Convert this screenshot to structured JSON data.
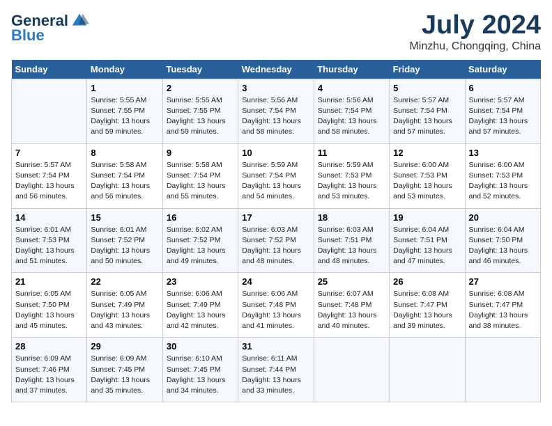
{
  "header": {
    "logo_general": "General",
    "logo_blue": "Blue",
    "title": "July 2024",
    "location": "Minzhu, Chongqing, China"
  },
  "days_of_week": [
    "Sunday",
    "Monday",
    "Tuesday",
    "Wednesday",
    "Thursday",
    "Friday",
    "Saturday"
  ],
  "weeks": [
    [
      {
        "day": "",
        "info": ""
      },
      {
        "day": "1",
        "info": "Sunrise: 5:55 AM\nSunset: 7:55 PM\nDaylight: 13 hours\nand 59 minutes."
      },
      {
        "day": "2",
        "info": "Sunrise: 5:55 AM\nSunset: 7:55 PM\nDaylight: 13 hours\nand 59 minutes."
      },
      {
        "day": "3",
        "info": "Sunrise: 5:56 AM\nSunset: 7:54 PM\nDaylight: 13 hours\nand 58 minutes."
      },
      {
        "day": "4",
        "info": "Sunrise: 5:56 AM\nSunset: 7:54 PM\nDaylight: 13 hours\nand 58 minutes."
      },
      {
        "day": "5",
        "info": "Sunrise: 5:57 AM\nSunset: 7:54 PM\nDaylight: 13 hours\nand 57 minutes."
      },
      {
        "day": "6",
        "info": "Sunrise: 5:57 AM\nSunset: 7:54 PM\nDaylight: 13 hours\nand 57 minutes."
      }
    ],
    [
      {
        "day": "7",
        "info": "Sunrise: 5:57 AM\nSunset: 7:54 PM\nDaylight: 13 hours\nand 56 minutes."
      },
      {
        "day": "8",
        "info": "Sunrise: 5:58 AM\nSunset: 7:54 PM\nDaylight: 13 hours\nand 56 minutes."
      },
      {
        "day": "9",
        "info": "Sunrise: 5:58 AM\nSunset: 7:54 PM\nDaylight: 13 hours\nand 55 minutes."
      },
      {
        "day": "10",
        "info": "Sunrise: 5:59 AM\nSunset: 7:54 PM\nDaylight: 13 hours\nand 54 minutes."
      },
      {
        "day": "11",
        "info": "Sunrise: 5:59 AM\nSunset: 7:53 PM\nDaylight: 13 hours\nand 53 minutes."
      },
      {
        "day": "12",
        "info": "Sunrise: 6:00 AM\nSunset: 7:53 PM\nDaylight: 13 hours\nand 53 minutes."
      },
      {
        "day": "13",
        "info": "Sunrise: 6:00 AM\nSunset: 7:53 PM\nDaylight: 13 hours\nand 52 minutes."
      }
    ],
    [
      {
        "day": "14",
        "info": "Sunrise: 6:01 AM\nSunset: 7:53 PM\nDaylight: 13 hours\nand 51 minutes."
      },
      {
        "day": "15",
        "info": "Sunrise: 6:01 AM\nSunset: 7:52 PM\nDaylight: 13 hours\nand 50 minutes."
      },
      {
        "day": "16",
        "info": "Sunrise: 6:02 AM\nSunset: 7:52 PM\nDaylight: 13 hours\nand 49 minutes."
      },
      {
        "day": "17",
        "info": "Sunrise: 6:03 AM\nSunset: 7:52 PM\nDaylight: 13 hours\nand 48 minutes."
      },
      {
        "day": "18",
        "info": "Sunrise: 6:03 AM\nSunset: 7:51 PM\nDaylight: 13 hours\nand 48 minutes."
      },
      {
        "day": "19",
        "info": "Sunrise: 6:04 AM\nSunset: 7:51 PM\nDaylight: 13 hours\nand 47 minutes."
      },
      {
        "day": "20",
        "info": "Sunrise: 6:04 AM\nSunset: 7:50 PM\nDaylight: 13 hours\nand 46 minutes."
      }
    ],
    [
      {
        "day": "21",
        "info": "Sunrise: 6:05 AM\nSunset: 7:50 PM\nDaylight: 13 hours\nand 45 minutes."
      },
      {
        "day": "22",
        "info": "Sunrise: 6:05 AM\nSunset: 7:49 PM\nDaylight: 13 hours\nand 43 minutes."
      },
      {
        "day": "23",
        "info": "Sunrise: 6:06 AM\nSunset: 7:49 PM\nDaylight: 13 hours\nand 42 minutes."
      },
      {
        "day": "24",
        "info": "Sunrise: 6:06 AM\nSunset: 7:48 PM\nDaylight: 13 hours\nand 41 minutes."
      },
      {
        "day": "25",
        "info": "Sunrise: 6:07 AM\nSunset: 7:48 PM\nDaylight: 13 hours\nand 40 minutes."
      },
      {
        "day": "26",
        "info": "Sunrise: 6:08 AM\nSunset: 7:47 PM\nDaylight: 13 hours\nand 39 minutes."
      },
      {
        "day": "27",
        "info": "Sunrise: 6:08 AM\nSunset: 7:47 PM\nDaylight: 13 hours\nand 38 minutes."
      }
    ],
    [
      {
        "day": "28",
        "info": "Sunrise: 6:09 AM\nSunset: 7:46 PM\nDaylight: 13 hours\nand 37 minutes."
      },
      {
        "day": "29",
        "info": "Sunrise: 6:09 AM\nSunset: 7:45 PM\nDaylight: 13 hours\nand 35 minutes."
      },
      {
        "day": "30",
        "info": "Sunrise: 6:10 AM\nSunset: 7:45 PM\nDaylight: 13 hours\nand 34 minutes."
      },
      {
        "day": "31",
        "info": "Sunrise: 6:11 AM\nSunset: 7:44 PM\nDaylight: 13 hours\nand 33 minutes."
      },
      {
        "day": "",
        "info": ""
      },
      {
        "day": "",
        "info": ""
      },
      {
        "day": "",
        "info": ""
      }
    ]
  ]
}
